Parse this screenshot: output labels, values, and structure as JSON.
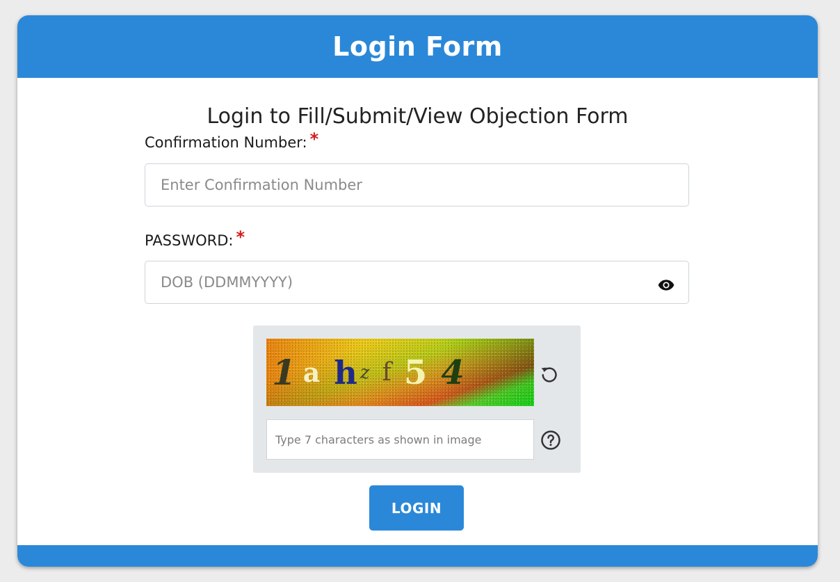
{
  "header": {
    "title": "Login Form"
  },
  "subtitle": "Login to Fill/Submit/View Objection Form",
  "confirmation": {
    "label": "Confirmation Number:",
    "required_mark": "*",
    "placeholder": "Enter Confirmation Number",
    "value": ""
  },
  "password": {
    "label": "PASSWORD:",
    "required_mark": "*",
    "placeholder": "DOB (DDMMYYYY)",
    "value": "",
    "toggle_icon": "eye-icon"
  },
  "captcha": {
    "characters": [
      "1",
      "a",
      "h",
      "z",
      "f",
      "5",
      "4"
    ],
    "refresh_icon": "refresh-icon",
    "input_placeholder": "Type 7 characters as shown in image",
    "input_value": "",
    "help_icon": "question-circle-icon"
  },
  "actions": {
    "login_label": "LOGIN"
  },
  "colors": {
    "primary": "#2b88d8",
    "required": "#d21c1c",
    "captcha_panel": "#e4e7ea",
    "page_background": "#ececec"
  }
}
